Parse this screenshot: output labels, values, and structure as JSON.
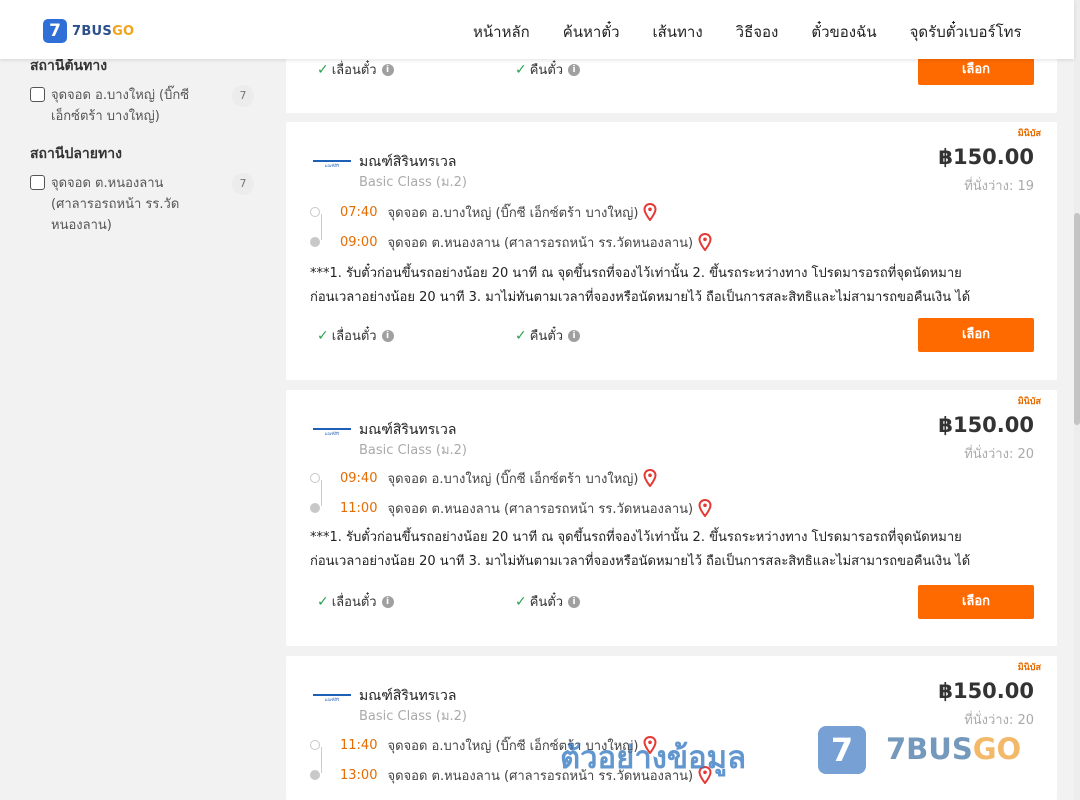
{
  "header": {
    "logo_mark": "7",
    "logo_text_a": "7BUS",
    "logo_text_b": "GO",
    "nav": [
      "หน้าหลัก",
      "ค้นหาตั๋ว",
      "เส้นทาง",
      "วิธีจอง",
      "ตั๋วของฉัน",
      "จุดรับตั๋วเบอร์โทร"
    ]
  },
  "sidebar": {
    "origin_title": "สถานีต้นทาง",
    "origin_item": {
      "label": "จุดจอด อ.บางใหญ่ (บิ๊กซี เอ็กซ์ตร้า บางใหญ่)",
      "count": "7"
    },
    "dest_title": "สถานีปลายทาง",
    "dest_item": {
      "label": "จุดจอด ต.หนองลาน (ศาลารอรถหน้า รร.วัดหนองลาน)",
      "count": "7"
    }
  },
  "common": {
    "refund": "เลื่อนตั๋ว",
    "cancel": "คืนตั๋ว",
    "select": "เลือก",
    "info": "i",
    "check": "✓"
  },
  "cards": [
    {
      "type": "มินิบัส",
      "operator": "มณฑ์สิรินทรเวล",
      "logo": "มณฑ์สิริ",
      "class": "Basic Class (ม.2)",
      "price": "฿150.00",
      "seats": "ที่นั่งว่าง: 19",
      "dep_time": "07:40",
      "dep": "จุดจอด อ.บางใหญ่ (บิ๊กซี เอ็กซ์ตร้า บางใหญ่)",
      "arr_time": "09:00",
      "arr": "จุดจอด ต.หนองลาน (ศาลารอรถหน้า รร.วัดหนองลาน)",
      "note1": "***1. รับตั๋วก่อนขึ้นรถอย่างน้อย 20 นาที ณ จุดขึ้นรถที่จองไว้เท่านั้น 2. ขึ้นรถระหว่างทาง โปรดมารอรถที่จุดนัดหมาย",
      "note2": "ก่อนเวลาอย่างน้อย 20 นาที 3. มาไม่ทันตามเวลาที่จองหรือนัดหมายไว้ ถือเป็นการสละสิทธิและไม่สามารถขอคืนเงิน ได้"
    },
    {
      "type": "มินิบัส",
      "operator": "มณฑ์สิรินทรเวล",
      "logo": "มณฑ์สิริ",
      "class": "Basic Class (ม.2)",
      "price": "฿150.00",
      "seats": "ที่นั่งว่าง: 20",
      "dep_time": "09:40",
      "dep": "จุดจอด อ.บางใหญ่ (บิ๊กซี เอ็กซ์ตร้า บางใหญ่)",
      "arr_time": "11:00",
      "arr": "จุดจอด ต.หนองลาน (ศาลารอรถหน้า รร.วัดหนองลาน)",
      "note1": "***1. รับตั๋วก่อนขึ้นรถอย่างน้อย 20 นาที ณ จุดขึ้นรถที่จองไว้เท่านั้น 2. ขึ้นรถระหว่างทาง โปรดมารอรถที่จุดนัดหมาย",
      "note2": "ก่อนเวลาอย่างน้อย 20 นาที 3. มาไม่ทันตามเวลาที่จองหรือนัดหมายไว้ ถือเป็นการสละสิทธิและไม่สามารถขอคืนเงิน ได้"
    },
    {
      "type": "มินิบัส",
      "operator": "มณฑ์สิรินทรเวล",
      "logo": "มณฑ์สิริ",
      "class": "Basic Class (ม.2)",
      "price": "฿150.00",
      "seats": "ที่นั่งว่าง: 20",
      "dep_time": "11:40",
      "dep": "จุดจอด อ.บางใหญ่ (บิ๊กซี เอ็กซ์ตร้า บางใหญ่)",
      "arr_time": "13:00",
      "arr": "จุดจอด ต.หนองลาน (ศาลารอรถหน้า รร.วัดหนองลาน)"
    }
  ],
  "watermark": {
    "text": "ตัวอย่างข้อมูล",
    "logo": "7",
    "brand_a": "7BUS",
    "brand_b": "GO"
  }
}
